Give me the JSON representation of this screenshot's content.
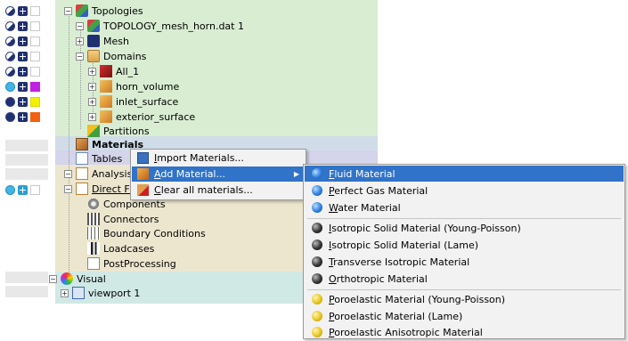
{
  "tree": {
    "topologies": "Topologies",
    "topology_file": "TOPOLOGY_mesh_horn.dat 1",
    "mesh": "Mesh",
    "domains": "Domains",
    "all_1": "All_1",
    "horn_volume": "horn_volume",
    "inlet_surface": "inlet_surface",
    "exterior_surface": "exterior_surface",
    "partitions": "Partitions",
    "materials": "Materials",
    "tables": "Tables",
    "analysis": "Analysis",
    "direct_fr": "Direct Fr",
    "components": "Components",
    "connectors": "Connectors",
    "boundary_conditions": "Boundary Conditions",
    "loadcases": "Loadcases",
    "postprocessing": "PostProcessing",
    "visual": "Visual",
    "viewport": "viewport 1"
  },
  "status_colors": {
    "horn_volume": "#c020e0",
    "inlet_surface": "#f0f000",
    "exterior_surface": "#f06010"
  },
  "context_menu": {
    "import": "Import Materials...",
    "add": "Add Material...",
    "clear": "Clear all materials..."
  },
  "submenu": {
    "fluid": "Fluid Material",
    "perfect_gas": "Perfect Gas Material",
    "water": "Water Material",
    "iso_young": "Isotropic Solid Material (Young-Poisson)",
    "iso_lame": "Isotropic Solid Material (Lame)",
    "transverse": "Transverse Isotropic Material",
    "orthotropic": "Orthotropic Material",
    "poro_young": "Poroelastic Material (Young-Poisson)",
    "poro_lame": "Poroelastic Material (Lame)",
    "poro_aniso": "Poroelastic Anisotropic Material"
  }
}
